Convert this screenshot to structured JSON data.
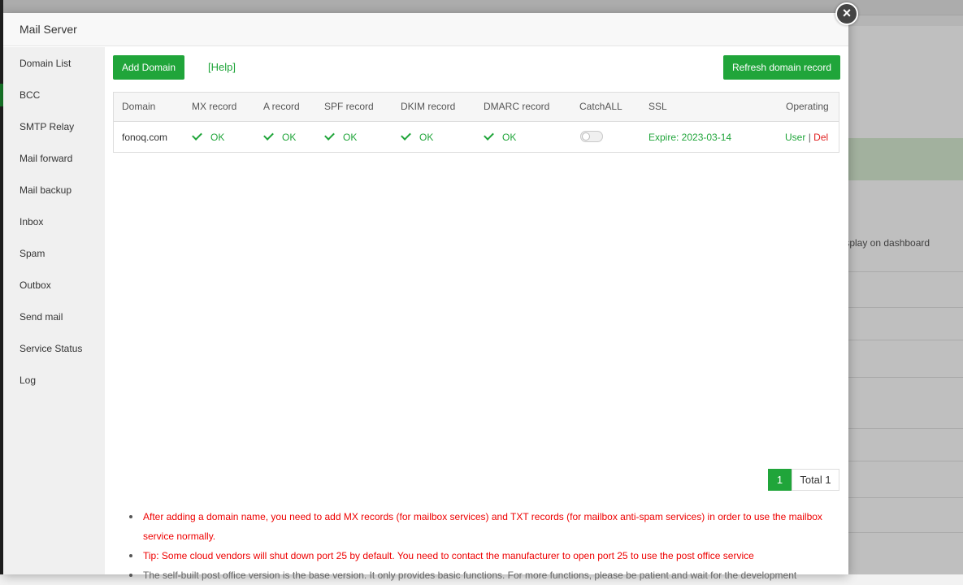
{
  "background": {
    "column_header": "Display on dashboard"
  },
  "dialog": {
    "title": "Mail Server",
    "close_symbol": "×"
  },
  "sidebar": {
    "items": [
      {
        "label": "Domain List"
      },
      {
        "label": "BCC"
      },
      {
        "label": "SMTP Relay"
      },
      {
        "label": "Mail forward"
      },
      {
        "label": "Mail backup"
      },
      {
        "label": "Inbox"
      },
      {
        "label": "Spam"
      },
      {
        "label": "Outbox"
      },
      {
        "label": "Send mail"
      },
      {
        "label": "Service Status"
      },
      {
        "label": "Log"
      }
    ]
  },
  "toolbar": {
    "add_domain": "Add Domain",
    "help": "[Help]",
    "refresh": "Refresh domain record"
  },
  "table": {
    "headers": [
      "Domain",
      "MX record",
      "A record",
      "SPF record",
      "DKIM record",
      "DMARC record",
      "CatchALL",
      "SSL",
      "Operating"
    ],
    "rows": [
      {
        "domain": "fonoq.com",
        "mx": "OK",
        "a": "OK",
        "spf": "OK",
        "dkim": "OK",
        "dmarc": "OK",
        "catchall": false,
        "ssl": "Expire: 2023-03-14",
        "op_user": "User",
        "op_sep": "|",
        "op_del": "Del"
      }
    ]
  },
  "pagination": {
    "current": "1",
    "total": "Total 1"
  },
  "tips": [
    "After adding a domain name, you need to add MX records (for mailbox services) and TXT records (for mailbox anti-spam services) in order to use the mailbox service normally.",
    "Tip: Some cloud vendors will shut down port 25 by default. You need to contact the manufacturer to open port 25 to use the post office service",
    "The self-built post office version is the base version. It only provides basic functions. For more functions, please be patient and wait for the development"
  ],
  "colors": {
    "accent": "#20a53a",
    "danger": "#ee0000"
  }
}
